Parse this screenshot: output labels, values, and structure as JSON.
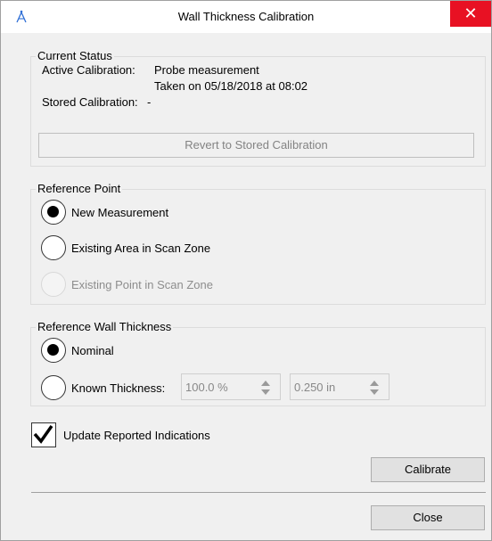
{
  "window": {
    "title": "Wall Thickness Calibration",
    "close_glyph": "✕"
  },
  "status": {
    "legend": "Current Status",
    "active_label": "Active Calibration:",
    "active_value": "Probe measurement",
    "active_detail": "Taken on 05/18/2018 at 08:02",
    "stored_label": "Stored Calibration:",
    "stored_value": "-",
    "revert_label": "Revert to Stored Calibration"
  },
  "reference_point": {
    "legend": "Reference Point",
    "options": [
      {
        "label": "New Measurement",
        "selected": true,
        "enabled": true
      },
      {
        "label": "Existing Area in Scan Zone",
        "selected": false,
        "enabled": true
      },
      {
        "label": "Existing Point in Scan Zone",
        "selected": false,
        "enabled": false
      }
    ]
  },
  "wall_thickness": {
    "legend": "Reference Wall Thickness",
    "nominal_label": "Nominal",
    "known_label": "Known Thickness:",
    "percent_value": "100.0 %",
    "inch_value": "0.250 in"
  },
  "update": {
    "label": "Update Reported Indications",
    "checked": true
  },
  "buttons": {
    "calibrate": "Calibrate",
    "close": "Close"
  },
  "colors": {
    "close_button": "#e81123",
    "dialog_bg": "#f0f0f0",
    "app_icon": "#2f6fd6"
  },
  "icons": {
    "app": "app-logo-icon",
    "close": "close-icon",
    "check": "checkmark-icon",
    "spin": "spin-arrows-icon"
  }
}
